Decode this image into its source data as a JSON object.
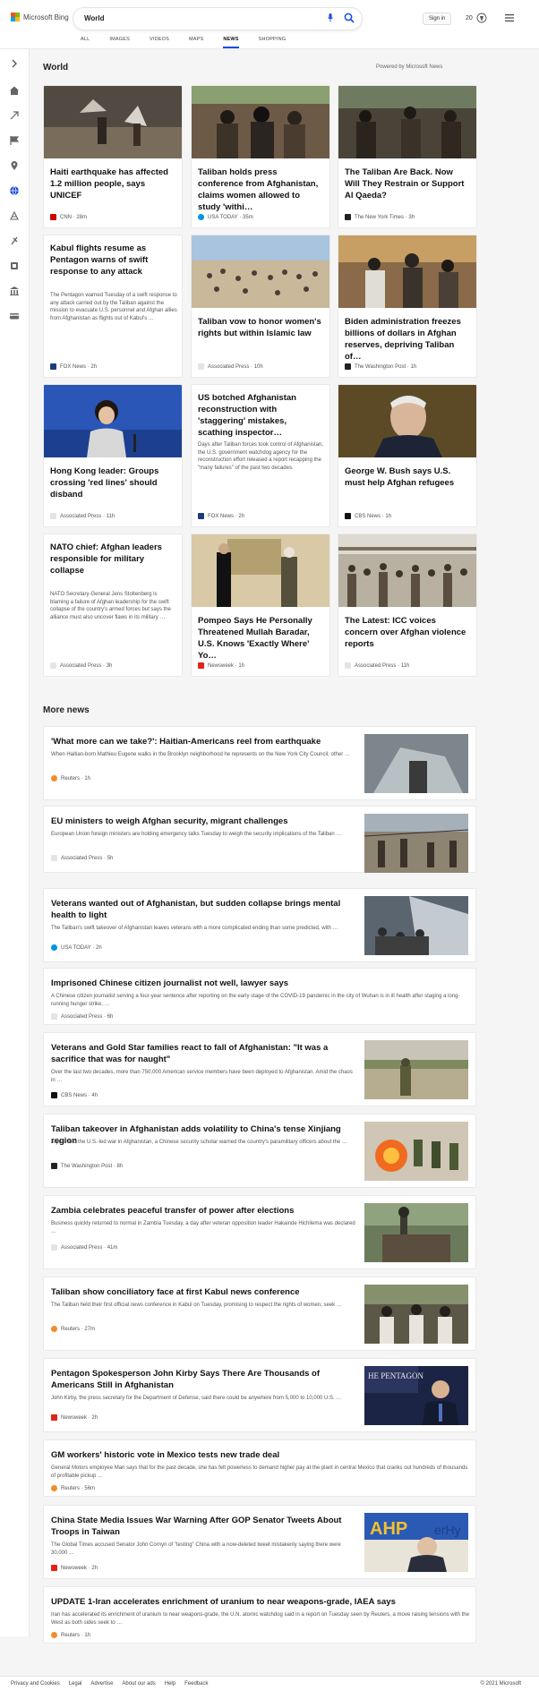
{
  "header": {
    "brand": "Microsoft Bing",
    "query": "World",
    "signin": "Sign in",
    "points": "20",
    "tabs": [
      "ALL",
      "IMAGES",
      "VIDEOS",
      "MAPS",
      "NEWS",
      "SHOPPING"
    ],
    "active_tab": "NEWS"
  },
  "colors": {
    "accent": "#174ae4",
    "ms_red": "#f25022",
    "ms_green": "#7fba00",
    "ms_blue": "#00a4ef",
    "ms_yellow": "#ffb900"
  },
  "world": {
    "title": "World",
    "powered": "Powered by Microsoft News",
    "cards": [
      {
        "title": "Haiti earthquake has affected 1.2 million people, says UNICEF",
        "snippet": "",
        "source": "CNN",
        "age": "28m"
      },
      {
        "title": "Taliban holds press conference from Afghanistan, claims women allowed to study 'withi…",
        "snippet": "",
        "source": "USA TODAY",
        "age": "35m"
      },
      {
        "title": "The Taliban Are Back. Now Will They Restrain or Support Al Qaeda?",
        "snippet": "",
        "source": "The New York Times",
        "age": "3h"
      },
      {
        "title": "Kabul flights resume as Pentagon warns of swift response to any attack",
        "snippet": "The Pentagon warned Tuesday of a swift response to any attack carried out by the Taliban against the mission to evacuate U.S. personnel and Afghan allies from Afghanistan as flights out of Kabul's …",
        "source": "FOX News",
        "age": "2h"
      },
      {
        "title": "Taliban vow to honor women's rights but within Islamic law",
        "snippet": "",
        "source": "Associated Press",
        "age": "10h"
      },
      {
        "title": "Biden administration freezes billions of dollars in Afghan reserves, depriving Taliban of…",
        "snippet": "",
        "source": "The Washington Post",
        "age": "1h"
      },
      {
        "title": "Hong Kong leader: Groups crossing 'red lines' should disband",
        "snippet": "",
        "source": "Associated Press",
        "age": "11h"
      },
      {
        "title": "US botched Afghanistan reconstruction with 'staggering' mistakes, scathing inspector…",
        "snippet": "Days after Taliban forces took control of Afghanistan, the U.S. government watchdog agency for the reconstruction effort released a report recapping the \"many failures\" of the past two decades.",
        "source": "FOX News",
        "age": "2h"
      },
      {
        "title": "George W. Bush says U.S. must help Afghan refugees",
        "snippet": "",
        "source": "CBS News",
        "age": "1h"
      },
      {
        "title": "NATO chief: Afghan leaders responsible for military collapse",
        "snippet": "NATO Secretary-General Jens Stoltenberg is blaming a failure of Afghan leadership for the swift collapse of the country's armed forces but says the alliance must also uncover flaws in its military …",
        "source": "Associated Press",
        "age": "3h"
      },
      {
        "title": "Pompeo Says He Personally Threatened Mullah Baradar, U.S. Knows 'Exactly Where' Yo…",
        "snippet": "",
        "source": "Newsweek",
        "age": "1h"
      },
      {
        "title": "The Latest: ICC voices concern over Afghan violence reports",
        "snippet": "",
        "source": "Associated Press",
        "age": "11h"
      }
    ]
  },
  "more_news": {
    "title": "More news",
    "items": [
      {
        "title": "'What more can we take?': Haitian-Americans reel from earthquake",
        "snippet": "When Haitian-born Mathieu Eugene walks in the Brooklyn neighborhood he represents on the New York City Council, other …",
        "source": "Reuters",
        "age": "1h"
      },
      {
        "title": "EU ministers to weigh Afghan security, migrant challenges",
        "snippet": "European Union foreign ministers are holding emergency talks Tuesday to weigh the security implications of the Taliban …",
        "source": "Associated Press",
        "age": "5h"
      },
      {
        "title": "Veterans wanted out of Afghanistan, but sudden collapse brings mental health to light",
        "snippet": "The Taliban's swift takeover of Afghanistan leaves veterans with a more complicated ending than some predicted, with …",
        "source": "USA TODAY",
        "age": "2h"
      },
      {
        "title": "Imprisoned Chinese citizen journalist not well, lawyer says",
        "snippet": "A Chinese citizen journalist serving a four-year sentence after reporting on the early stage of the COVID-19 pandemic in the city of Wuhan is in ill health after staging a long-running hunger strike, …",
        "source": "Associated Press",
        "age": "6h"
      },
      {
        "title": "Veterans and Gold Star families react to fall of Afghanistan: \"It was a sacrifice that was for naught\"",
        "snippet": "Over the last two decades, more than 750,000 American service members have been deployed to Afghanistan. Amid the chaos in …",
        "source": "CBS News",
        "age": "4h"
      },
      {
        "title": "Taliban takeover in Afghanistan adds volatility to China's tense Xinjiang region",
        "snippet": "A year into the U.S.-led war in Afghanistan, a Chinese security scholar warned the country's paramilitary officers about the …",
        "source": "The Washington Post",
        "age": "8h"
      },
      {
        "title": "Zambia celebrates peaceful transfer of power after elections",
        "snippet": "Business quickly returned to normal in Zambia Tuesday, a day after veteran opposition leader Hakainde Hichilema was declared …",
        "source": "Associated Press",
        "age": "41m"
      },
      {
        "title": "Taliban show conciliatory face at first Kabul news conference",
        "snippet": "The Taliban held their first official news conference in Kabul on Tuesday, promising to respect the rights of women, seek …",
        "source": "Reuters",
        "age": "27m"
      },
      {
        "title": "Pentagon Spokesperson John Kirby Says There Are Thousands of Americans Still in Afghanistan",
        "snippet": "John Kirby, the press secretary for the Department of Defense, said there could be anywhere from 5,000 to 10,000 U.S. …",
        "source": "Newsweek",
        "age": "2h"
      },
      {
        "title": "GM workers' historic vote in Mexico tests new trade deal",
        "snippet": "General Motors employee Mari says that for the past decade, she has felt powerless to demand higher pay at the plant in central Mexico that cranks out hundreds of thousands of profitable pickup …",
        "source": "Reuters",
        "age": "56m"
      },
      {
        "title": "China State Media Issues War Warning After GOP Senator Tweets About Troops in Taiwan",
        "snippet": "The Global Times accused Senator John Cornyn of \"testing\" China with a now-deleted tweet mistakenly saying there were 30,000 …",
        "source": "Newsweek",
        "age": "2h"
      },
      {
        "title": "UPDATE 1-Iran accelerates enrichment of uranium to near weapons-grade, IAEA says",
        "snippet": "Iran has accelerated its enrichment of uranium to near weapons-grade, the U.N. atomic watchdog said in a report on Tuesday seen by Reuters, a move raising tensions with the West as both sides seek to …",
        "source": "Reuters",
        "age": "1h"
      }
    ]
  },
  "footer": {
    "links": [
      "Privacy and Cookies",
      "Legal",
      "Advertise",
      "About our ads",
      "Help",
      "Feedback"
    ],
    "copyright": "© 2021 Microsoft"
  }
}
